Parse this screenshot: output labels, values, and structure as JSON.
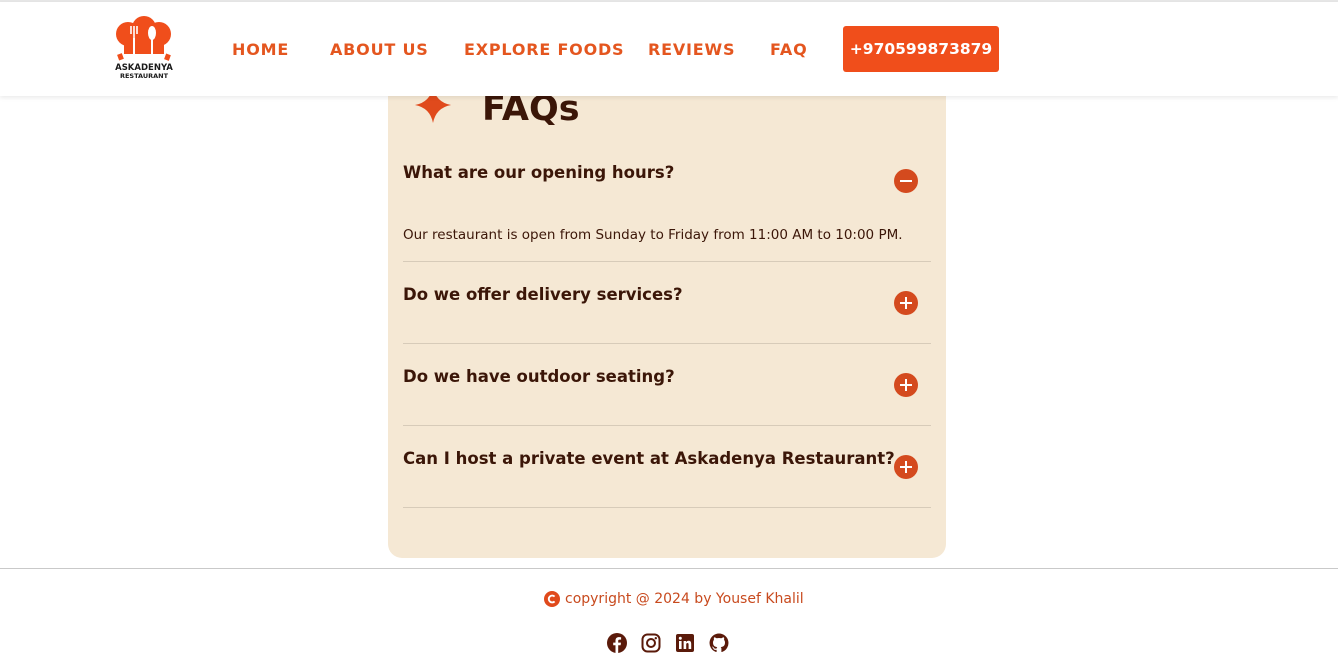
{
  "brand": {
    "logo_line1": "ASKADENYA",
    "logo_line2": "RESTAURANT",
    "accent_color": "#f04e1b"
  },
  "nav": {
    "items": [
      {
        "label": "HOME"
      },
      {
        "label": "ABOUT US"
      },
      {
        "label": "EXPLORE FOODS"
      },
      {
        "label": "REVIEWS"
      },
      {
        "label": "FAQ"
      }
    ],
    "phone": "+970599873879"
  },
  "faq": {
    "title": "FAQs",
    "items": [
      {
        "question": "What are our opening hours?",
        "answer": "Our restaurant is open from Sunday to Friday from 11:00 AM to 10:00 PM.",
        "expanded": true,
        "toggle_icon": "minus-icon"
      },
      {
        "question": "Do we offer delivery services?",
        "expanded": false,
        "toggle_icon": "plus-icon"
      },
      {
        "question": "Do we have outdoor seating?",
        "expanded": false,
        "toggle_icon": "plus-icon"
      },
      {
        "question": "Can I host a private event at Askadenya Restaurant?",
        "expanded": false,
        "toggle_icon": "plus-icon"
      }
    ]
  },
  "footer": {
    "copyright": "copyright @ 2024 by Yousef Khalil",
    "socials": [
      "facebook-icon",
      "instagram-icon",
      "linkedin-icon",
      "github-icon"
    ]
  }
}
